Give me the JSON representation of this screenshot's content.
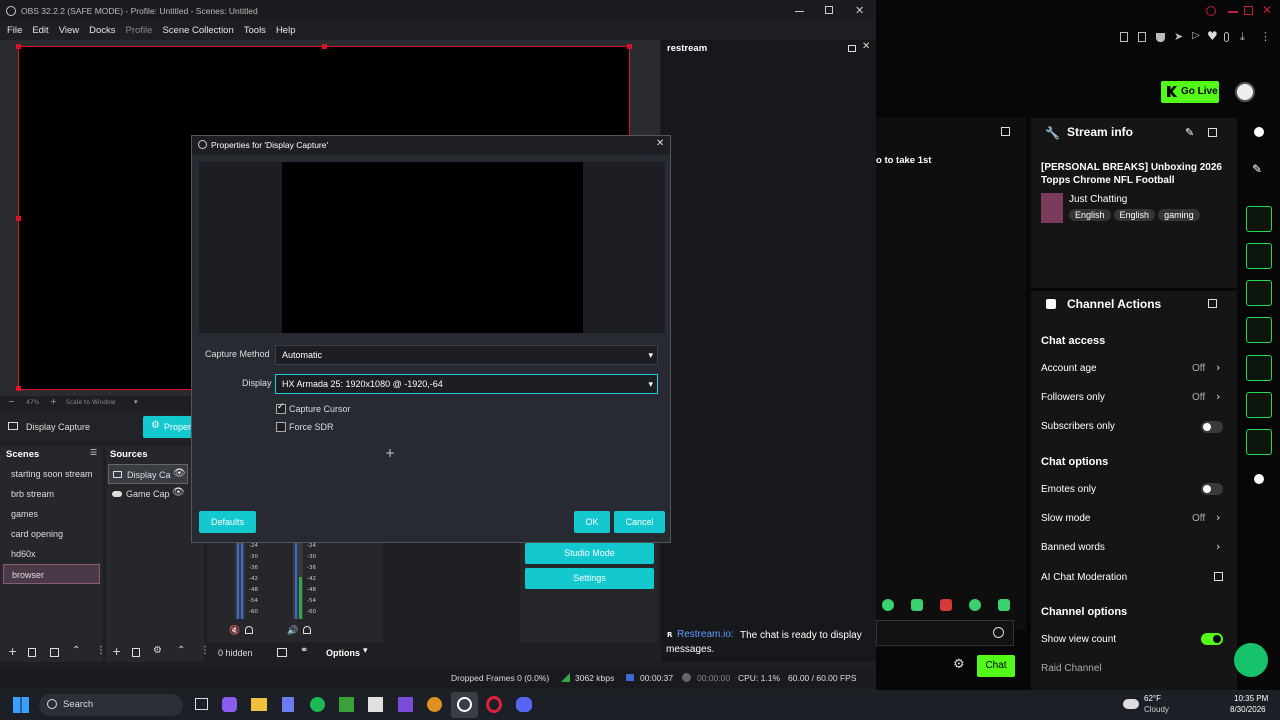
{
  "obs": {
    "window_title": "OBS 32.2.2 (SAFE MODE) - Profile: Untitled - Scenes: Untitled",
    "menu": [
      "File",
      "Edit",
      "View",
      "Docks",
      "Profile",
      "Scene Collection",
      "Tools",
      "Help"
    ],
    "zoom": "47%",
    "scale_mode": "Scale to Window",
    "source_toolbar_label": "Display Capture",
    "properties_btn": "Proper",
    "restream_dock_title": "restream",
    "scenes_title": "Scenes",
    "sources_title": "Sources",
    "scenes": [
      "starting soon stream",
      "brb stream",
      "games",
      "card opening",
      "hd60x",
      "browser"
    ],
    "sources": [
      "Display Ca",
      "Game Cap"
    ],
    "mixer_ticks": [
      "-24",
      "-30",
      "-36",
      "-42",
      "-48",
      "-54",
      "-60"
    ],
    "hidden_count": "0 hidden",
    "options_label": "Options",
    "controls": [
      "Studio Mode",
      "Settings"
    ],
    "restream_brand": "Restream.io:",
    "restream_msg": "The chat is ready to display messages.",
    "status": {
      "dropped": "Dropped Frames 0 (0.0%)",
      "kbps": "3062 kbps",
      "rec_time": "00:00:37",
      "stream_time": "00:00:00",
      "cpu": "CPU: 1.1%",
      "fps": "60.00 / 60.00 FPS"
    }
  },
  "dialog": {
    "title": "Properties for 'Display Capture'",
    "capture_method_label": "Capture Method",
    "capture_method_value": "Automatic",
    "display_label": "Display",
    "display_value": "HX Armada 25: 1920x1080 @ -1920,-64",
    "capture_cursor": "Capture Cursor",
    "force_sdr": "Force SDR",
    "defaults_btn": "Defaults",
    "ok_btn": "OK",
    "cancel_btn": "Cancel"
  },
  "kick": {
    "go_live": "Go Live",
    "chat_snippet": "o to take 1st",
    "stream_info_title": "Stream info",
    "stream_title": "[PERSONAL BREAKS] Unboxing 2026 Topps Chrome NFL Football",
    "category": "Just Chatting",
    "tags": [
      "English",
      "English",
      "gaming"
    ],
    "channel_actions_title": "Channel Actions",
    "chat_access": "Chat access",
    "account_age": "Account age",
    "followers_only": "Followers only",
    "subscribers_only": "Subscribers only",
    "off": "Off",
    "chat_options": "Chat options",
    "emotes_only": "Emotes only",
    "slow_mode": "Slow mode",
    "banned_words": "Banned words",
    "ai_moderation": "AI Chat Moderation",
    "channel_options": "Channel options",
    "show_view_count": "Show view count",
    "raid_channel": "Raid Channel",
    "chat_btn": "Chat"
  },
  "taskbar": {
    "search": "Search",
    "temp": "62°F",
    "weather": "Cloudy",
    "time": "10:35 PM",
    "date": "8/30/2026"
  },
  "colors": {
    "kick_green": "#53fc18",
    "obs_cyan": "#14c8d0",
    "preview_red": "#e0102a"
  }
}
